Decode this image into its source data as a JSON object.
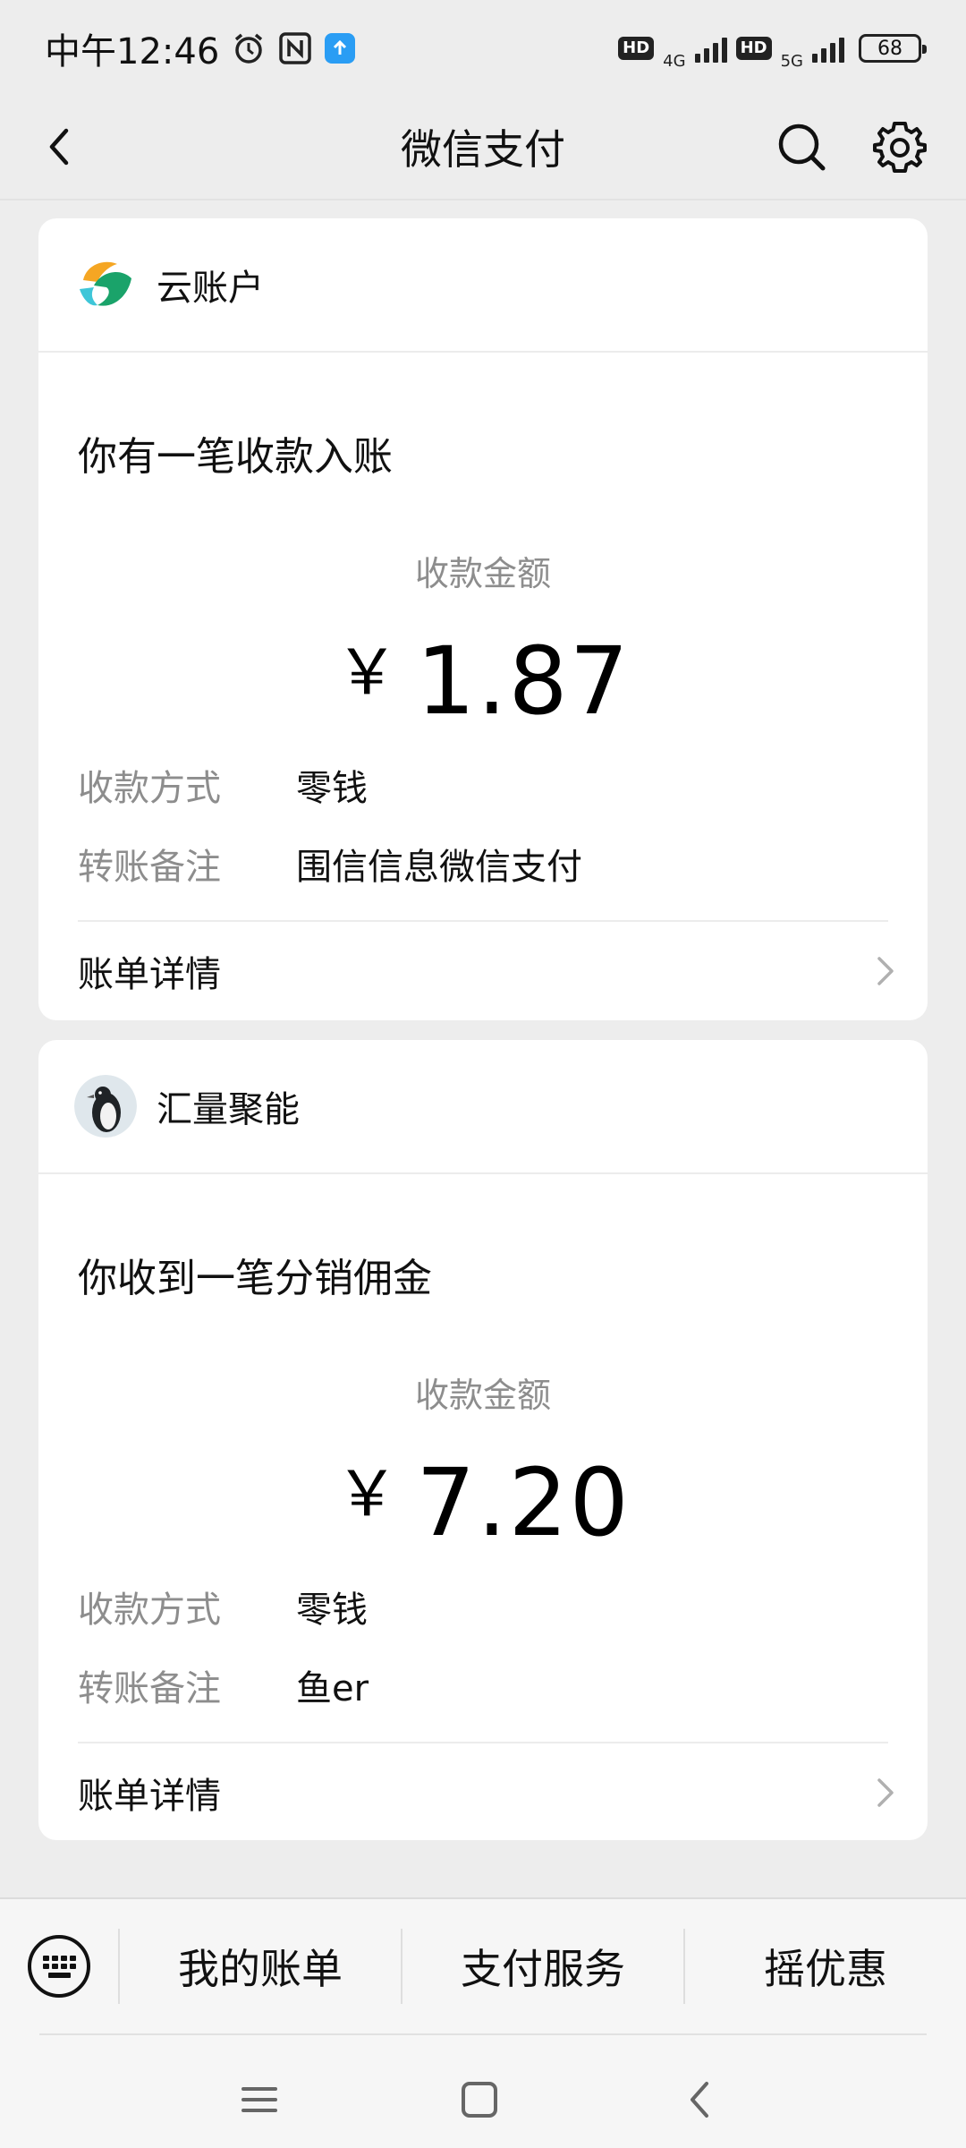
{
  "status_bar": {
    "time": "中午12:46",
    "network_1": "4G",
    "network_2": "5G",
    "hd_1": "HD",
    "hd_2": "HD",
    "battery": "68"
  },
  "header": {
    "title": "微信支付"
  },
  "cards": [
    {
      "account_name": "云账户",
      "headline": "你有一笔收款入账",
      "amount_label": "收款金额",
      "currency": "￥",
      "amount": "1.87",
      "rows": [
        {
          "key": "收款方式",
          "value": "零钱"
        },
        {
          "key": "转账备注",
          "value": "围信信息微信支付"
        }
      ],
      "detail_label": "账单详情"
    },
    {
      "account_name": "汇量聚能",
      "headline": "你收到一笔分销佣金",
      "amount_label": "收款金额",
      "currency": "￥",
      "amount": "7.20",
      "rows": [
        {
          "key": "收款方式",
          "value": "零钱"
        },
        {
          "key": "转账备注",
          "value": "鱼er"
        }
      ],
      "detail_label": "账单详情"
    }
  ],
  "bottom_menu": {
    "items": [
      "我的账单",
      "支付服务",
      "摇优惠"
    ]
  },
  "colors": {
    "background": "#ededed",
    "card": "#ffffff",
    "muted_text": "#8d8d8d"
  }
}
